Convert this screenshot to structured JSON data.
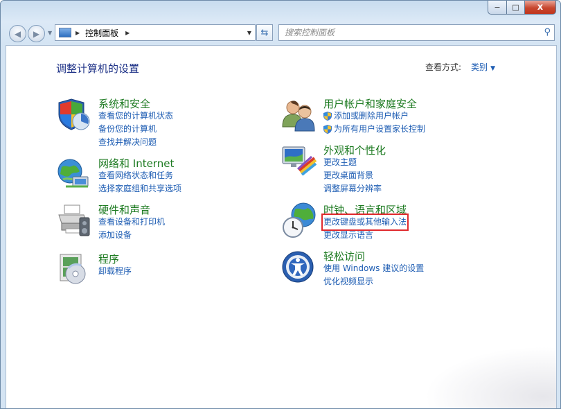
{
  "window": {
    "minimize_label": "−",
    "maximize_label": "□",
    "close_label": "x"
  },
  "nav": {
    "back_icon": "back-arrow-icon",
    "forward_icon": "forward-arrow-icon",
    "breadcrumb": "控制面板",
    "refresh_icon": "refresh-icon",
    "search_placeholder": "搜索控制面板",
    "search_icon": "search-icon"
  },
  "content": {
    "title": "调整计算机的设置",
    "view_by_label": "查看方式:",
    "view_by_value": "类别"
  },
  "categories_left": [
    {
      "title": "系统和安全",
      "icon": "shield-system-icon",
      "links": [
        "查看您的计算机状态",
        "备份您的计算机",
        "查找并解决问题"
      ]
    },
    {
      "title": "网络和 Internet",
      "icon": "network-globe-icon",
      "links": [
        "查看网络状态和任务",
        "选择家庭组和共享选项"
      ]
    },
    {
      "title": "硬件和声音",
      "icon": "printer-icon",
      "links": [
        "查看设备和打印机",
        "添加设备"
      ]
    },
    {
      "title": "程序",
      "icon": "program-disc-icon",
      "links": [
        "卸载程序"
      ]
    }
  ],
  "categories_right": [
    {
      "title": "用户帐户和家庭安全",
      "icon": "users-icon",
      "links": [
        "添加或删除用户帐户",
        "为所有用户设置家长控制"
      ]
    },
    {
      "title": "外观和个性化",
      "icon": "monitor-paint-icon",
      "links": [
        "更改主题",
        "更改桌面背景",
        "调整屏幕分辨率"
      ]
    },
    {
      "title": "时钟、语言和区域",
      "icon": "globe-clock-icon",
      "links": [
        "更改键盘或其他输入法",
        "更改显示语言"
      ]
    },
    {
      "title": "轻松访问",
      "icon": "ease-of-access-icon",
      "links": [
        "使用 Windows 建议的设置",
        "优化视频显示"
      ]
    }
  ],
  "colors": {
    "category_title": "#1c7a20",
    "link": "#1e5db3",
    "page_title": "#1e3287",
    "highlight_box": "#e0282c"
  }
}
